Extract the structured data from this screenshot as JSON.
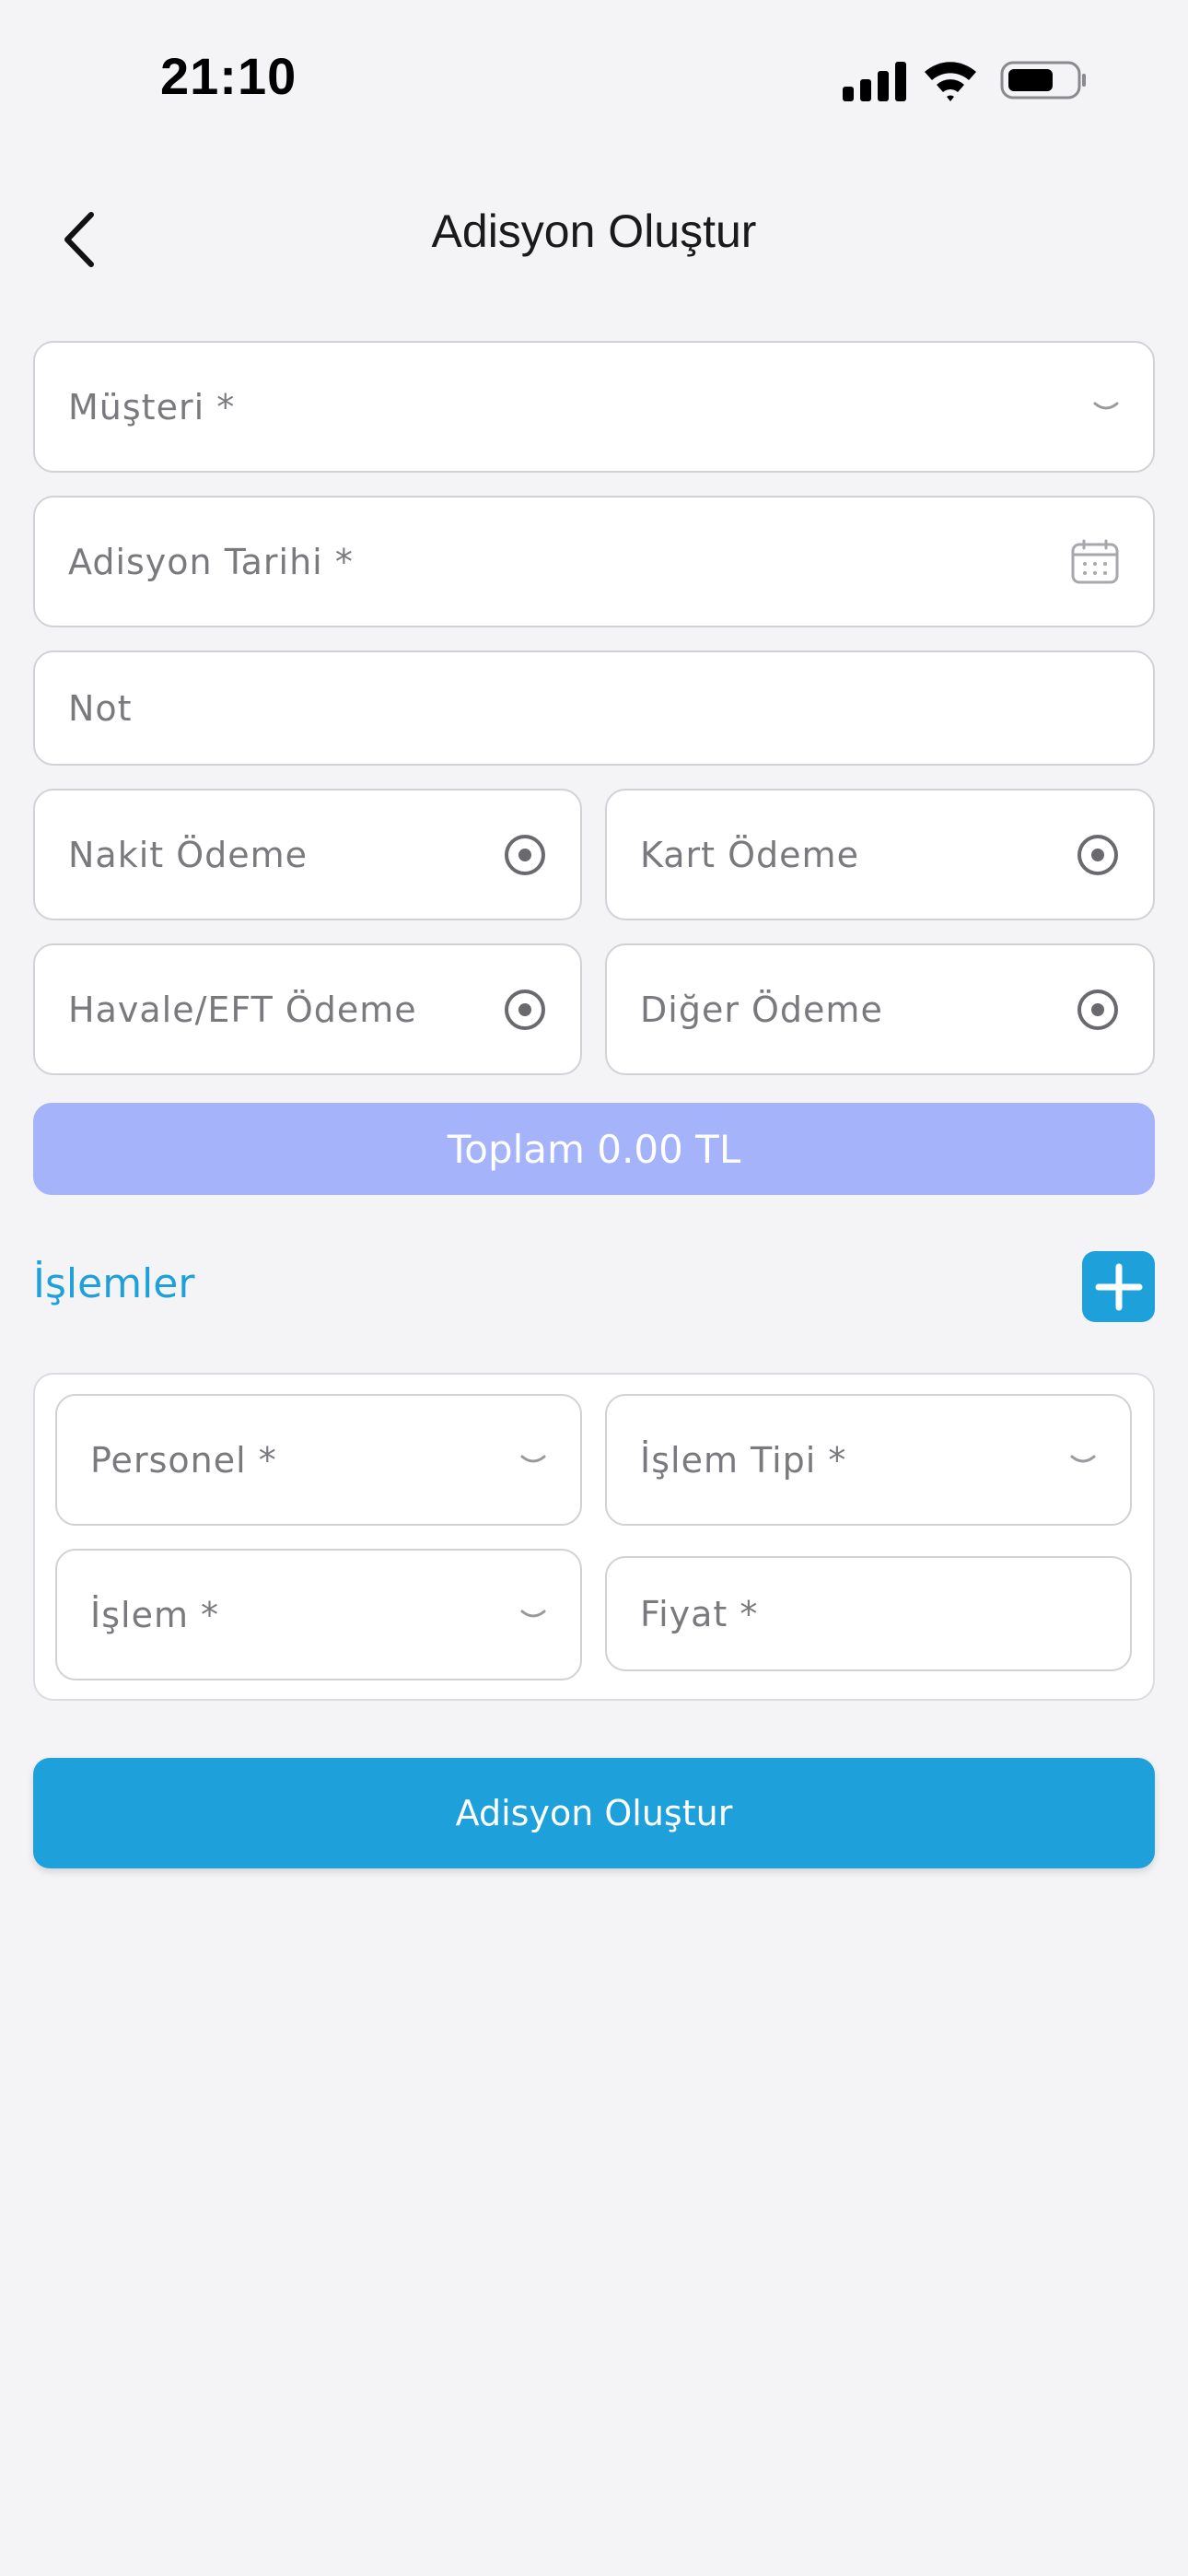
{
  "status_bar": {
    "time": "21:10",
    "icons": [
      "signal-icon",
      "wifi-icon",
      "battery-icon"
    ]
  },
  "header": {
    "title": "Adisyon Oluştur",
    "back_icon": "chevron-left-icon"
  },
  "form": {
    "customer_placeholder": "Müşteri *",
    "date_placeholder": "Adisyon Tarihi *",
    "note_placeholder": "Not",
    "payments": {
      "cash": "Nakit Ödeme",
      "card": "Kart Ödeme",
      "transfer": "Havale/EFT Ödeme",
      "other": "Diğer Ödeme"
    },
    "total": "Toplam 0.00 TL"
  },
  "operations": {
    "title": "İşlemler",
    "add_icon": "plus-icon",
    "staff_placeholder": "Personel *",
    "type_placeholder": "İşlem Tipi *",
    "operation_placeholder": "İşlem *",
    "price_placeholder": "Fiyat *"
  },
  "submit_label": "Adisyon Oluştur",
  "colors": {
    "accent": "#1ea0da",
    "total_bar": "#a5b3fb",
    "background": "#f4f4f6",
    "field_border": "#d2d2d6",
    "placeholder_text": "#7a7a7e"
  }
}
